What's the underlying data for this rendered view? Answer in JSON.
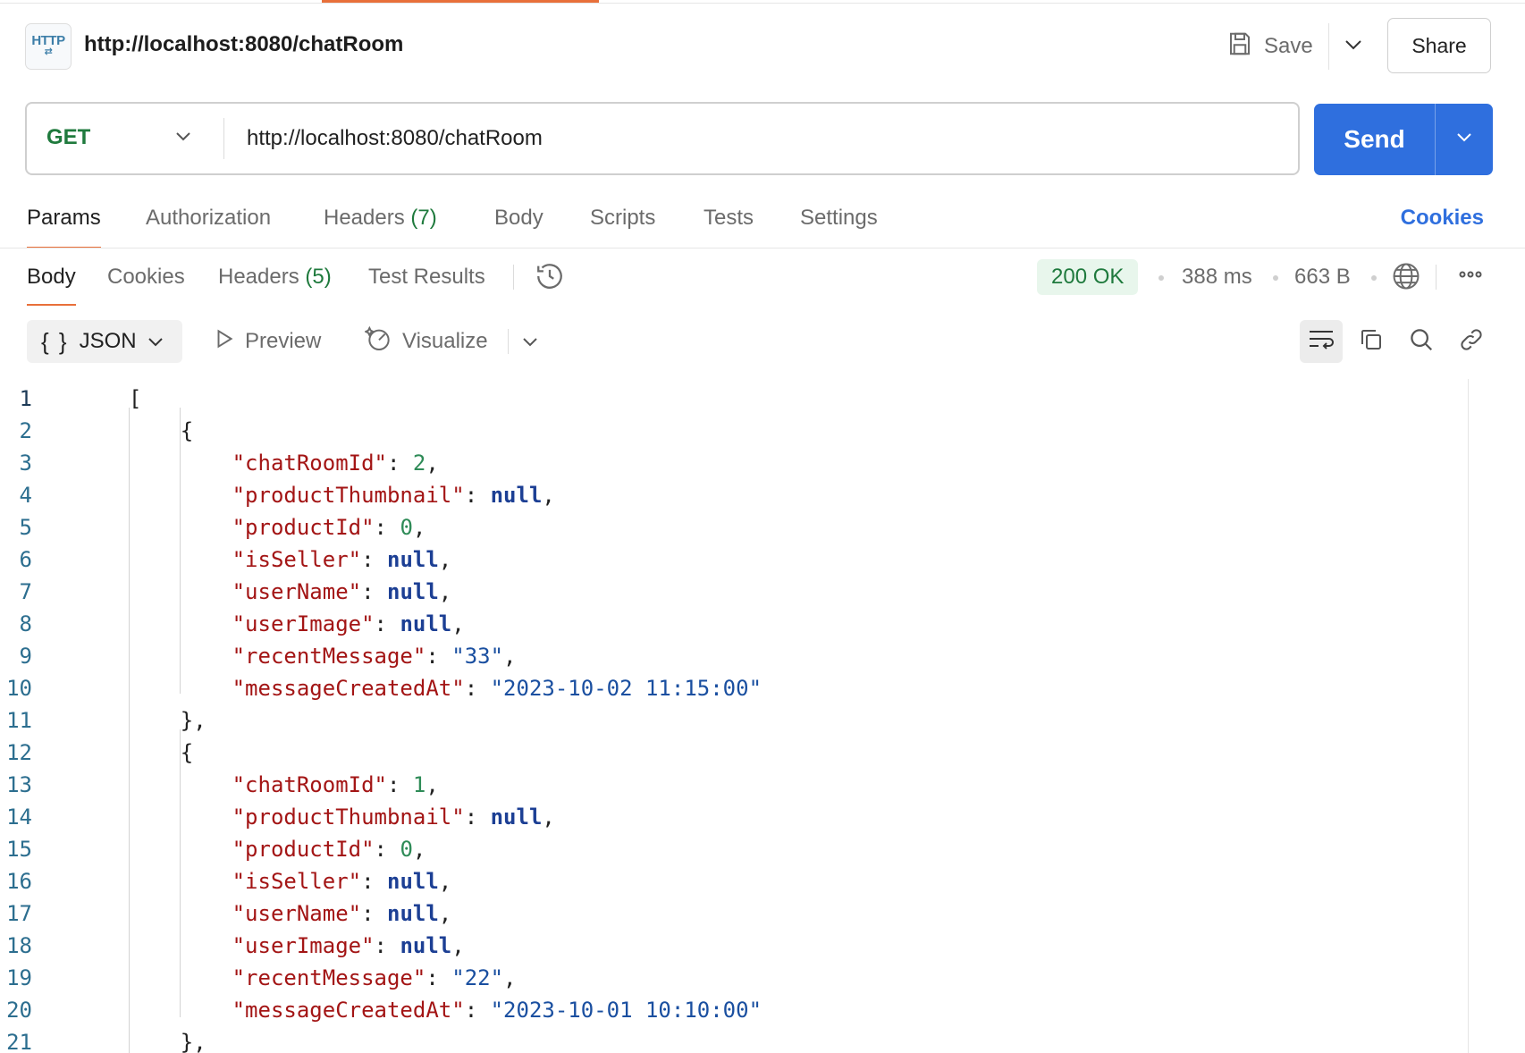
{
  "header": {
    "http_icon_text": "HTTP",
    "title": "http://localhost:8080/chatRoom",
    "save_label": "Save",
    "share_label": "Share"
  },
  "request": {
    "method": "GET",
    "url": "http://localhost:8080/chatRoom",
    "send_label": "Send"
  },
  "request_tabs": [
    {
      "label": "Params",
      "count": ""
    },
    {
      "label": "Authorization",
      "count": ""
    },
    {
      "label": "Headers",
      "count": "(7)"
    },
    {
      "label": "Body",
      "count": ""
    },
    {
      "label": "Scripts",
      "count": ""
    },
    {
      "label": "Tests",
      "count": ""
    },
    {
      "label": "Settings",
      "count": ""
    }
  ],
  "cookies_label": "Cookies",
  "response_tabs": [
    {
      "label": "Body",
      "count": ""
    },
    {
      "label": "Cookies",
      "count": ""
    },
    {
      "label": "Headers",
      "count": "(5)"
    },
    {
      "label": "Test Results",
      "count": ""
    }
  ],
  "response_meta": {
    "status": "200 OK",
    "time": "388 ms",
    "size": "663 B"
  },
  "response_toolbar": {
    "format_label": "JSON",
    "preview_label": "Preview",
    "visualize_label": "Visualize"
  },
  "code_lines": [
    {
      "n": "1",
      "tokens": [
        {
          "t": "p",
          "v": "["
        }
      ]
    },
    {
      "n": "2",
      "tokens": [
        {
          "t": "p",
          "v": "    {"
        }
      ]
    },
    {
      "n": "3",
      "tokens": [
        {
          "t": "p",
          "v": "        "
        },
        {
          "t": "k",
          "v": "\"chatRoomId\""
        },
        {
          "t": "p",
          "v": ": "
        },
        {
          "t": "n",
          "v": "2"
        },
        {
          "t": "p",
          "v": ","
        }
      ]
    },
    {
      "n": "4",
      "tokens": [
        {
          "t": "p",
          "v": "        "
        },
        {
          "t": "k",
          "v": "\"productThumbnail\""
        },
        {
          "t": "p",
          "v": ": "
        },
        {
          "t": "nl",
          "v": "null"
        },
        {
          "t": "p",
          "v": ","
        }
      ]
    },
    {
      "n": "5",
      "tokens": [
        {
          "t": "p",
          "v": "        "
        },
        {
          "t": "k",
          "v": "\"productId\""
        },
        {
          "t": "p",
          "v": ": "
        },
        {
          "t": "n",
          "v": "0"
        },
        {
          "t": "p",
          "v": ","
        }
      ]
    },
    {
      "n": "6",
      "tokens": [
        {
          "t": "p",
          "v": "        "
        },
        {
          "t": "k",
          "v": "\"isSeller\""
        },
        {
          "t": "p",
          "v": ": "
        },
        {
          "t": "nl",
          "v": "null"
        },
        {
          "t": "p",
          "v": ","
        }
      ]
    },
    {
      "n": "7",
      "tokens": [
        {
          "t": "p",
          "v": "        "
        },
        {
          "t": "k",
          "v": "\"userName\""
        },
        {
          "t": "p",
          "v": ": "
        },
        {
          "t": "nl",
          "v": "null"
        },
        {
          "t": "p",
          "v": ","
        }
      ]
    },
    {
      "n": "8",
      "tokens": [
        {
          "t": "p",
          "v": "        "
        },
        {
          "t": "k",
          "v": "\"userImage\""
        },
        {
          "t": "p",
          "v": ": "
        },
        {
          "t": "nl",
          "v": "null"
        },
        {
          "t": "p",
          "v": ","
        }
      ]
    },
    {
      "n": "9",
      "tokens": [
        {
          "t": "p",
          "v": "        "
        },
        {
          "t": "k",
          "v": "\"recentMessage\""
        },
        {
          "t": "p",
          "v": ": "
        },
        {
          "t": "s",
          "v": "\"33\""
        },
        {
          "t": "p",
          "v": ","
        }
      ]
    },
    {
      "n": "10",
      "tokens": [
        {
          "t": "p",
          "v": "        "
        },
        {
          "t": "k",
          "v": "\"messageCreatedAt\""
        },
        {
          "t": "p",
          "v": ": "
        },
        {
          "t": "s",
          "v": "\"2023-10-02 11:15:00\""
        }
      ]
    },
    {
      "n": "11",
      "tokens": [
        {
          "t": "p",
          "v": "    },"
        }
      ]
    },
    {
      "n": "12",
      "tokens": [
        {
          "t": "p",
          "v": "    {"
        }
      ]
    },
    {
      "n": "13",
      "tokens": [
        {
          "t": "p",
          "v": "        "
        },
        {
          "t": "k",
          "v": "\"chatRoomId\""
        },
        {
          "t": "p",
          "v": ": "
        },
        {
          "t": "n",
          "v": "1"
        },
        {
          "t": "p",
          "v": ","
        }
      ]
    },
    {
      "n": "14",
      "tokens": [
        {
          "t": "p",
          "v": "        "
        },
        {
          "t": "k",
          "v": "\"productThumbnail\""
        },
        {
          "t": "p",
          "v": ": "
        },
        {
          "t": "nl",
          "v": "null"
        },
        {
          "t": "p",
          "v": ","
        }
      ]
    },
    {
      "n": "15",
      "tokens": [
        {
          "t": "p",
          "v": "        "
        },
        {
          "t": "k",
          "v": "\"productId\""
        },
        {
          "t": "p",
          "v": ": "
        },
        {
          "t": "n",
          "v": "0"
        },
        {
          "t": "p",
          "v": ","
        }
      ]
    },
    {
      "n": "16",
      "tokens": [
        {
          "t": "p",
          "v": "        "
        },
        {
          "t": "k",
          "v": "\"isSeller\""
        },
        {
          "t": "p",
          "v": ": "
        },
        {
          "t": "nl",
          "v": "null"
        },
        {
          "t": "p",
          "v": ","
        }
      ]
    },
    {
      "n": "17",
      "tokens": [
        {
          "t": "p",
          "v": "        "
        },
        {
          "t": "k",
          "v": "\"userName\""
        },
        {
          "t": "p",
          "v": ": "
        },
        {
          "t": "nl",
          "v": "null"
        },
        {
          "t": "p",
          "v": ","
        }
      ]
    },
    {
      "n": "18",
      "tokens": [
        {
          "t": "p",
          "v": "        "
        },
        {
          "t": "k",
          "v": "\"userImage\""
        },
        {
          "t": "p",
          "v": ": "
        },
        {
          "t": "nl",
          "v": "null"
        },
        {
          "t": "p",
          "v": ","
        }
      ]
    },
    {
      "n": "19",
      "tokens": [
        {
          "t": "p",
          "v": "        "
        },
        {
          "t": "k",
          "v": "\"recentMessage\""
        },
        {
          "t": "p",
          "v": ": "
        },
        {
          "t": "s",
          "v": "\"22\""
        },
        {
          "t": "p",
          "v": ","
        }
      ]
    },
    {
      "n": "20",
      "tokens": [
        {
          "t": "p",
          "v": "        "
        },
        {
          "t": "k",
          "v": "\"messageCreatedAt\""
        },
        {
          "t": "p",
          "v": ": "
        },
        {
          "t": "s",
          "v": "\"2023-10-01 10:10:00\""
        }
      ]
    },
    {
      "n": "21",
      "tokens": [
        {
          "t": "p",
          "v": "    },"
        }
      ]
    }
  ],
  "colors": {
    "accent": "#e8703a",
    "send": "#2f6fde",
    "status_ok": "#1f7a3d",
    "json_key": "#a31515",
    "json_number": "#2e8b57",
    "json_string": "#1a4fa0",
    "json_null": "#1c3f94"
  }
}
